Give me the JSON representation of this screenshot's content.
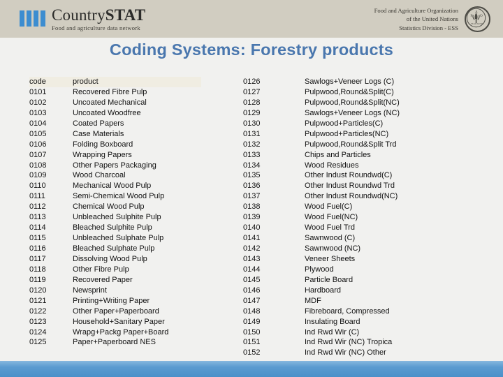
{
  "banner": {
    "brand_name_part1": "Country",
    "brand_name_part2": "STAT",
    "brand_tagline": "Food and agriculture data network",
    "fao_line1": "Food and Agriculture Organization",
    "fao_line2": "of the United Nations",
    "fao_line3": "Statistics Division - ESS",
    "fao_emblem_letters": "FAO",
    "fao_emblem_motto": "FIAT PANIS",
    "brand_bar_color": "#3d8dd0",
    "banner_color": "#d1cdc1"
  },
  "title": "Coding Systems: Forestry products",
  "table": {
    "headers": {
      "code": "code",
      "product": "product"
    },
    "left_rows": [
      {
        "code": "0101",
        "product": "Recovered Fibre Pulp"
      },
      {
        "code": "0102",
        "product": "Uncoated Mechanical"
      },
      {
        "code": "0103",
        "product": "Uncoated Woodfree"
      },
      {
        "code": "0104",
        "product": "Coated Papers"
      },
      {
        "code": "0105",
        "product": "Case Materials"
      },
      {
        "code": "0106",
        "product": "Folding Boxboard"
      },
      {
        "code": "0107",
        "product": "Wrapping Papers"
      },
      {
        "code": "0108",
        "product": "Other Papers Packaging"
      },
      {
        "code": "0109",
        "product": "Wood Charcoal"
      },
      {
        "code": "0110",
        "product": "Mechanical Wood Pulp"
      },
      {
        "code": "0111",
        "product": "Semi-Chemical Wood Pulp"
      },
      {
        "code": "0112",
        "product": "Chemical Wood Pulp"
      },
      {
        "code": "0113",
        "product": "Unbleached Sulphite Pulp"
      },
      {
        "code": "0114",
        "product": "Bleached Sulphite Pulp"
      },
      {
        "code": "0115",
        "product": "Unbleached Sulphate Pulp"
      },
      {
        "code": "0116",
        "product": "Bleached Sulphate Pulp"
      },
      {
        "code": "0117",
        "product": "Dissolving Wood Pulp"
      },
      {
        "code": "0118",
        "product": "Other Fibre Pulp"
      },
      {
        "code": "0119",
        "product": "Recovered Paper"
      },
      {
        "code": "0120",
        "product": "Newsprint"
      },
      {
        "code": "0121",
        "product": "Printing+Writing Paper"
      },
      {
        "code": "0122",
        "product": "Other Paper+Paperboard"
      },
      {
        "code": "0123",
        "product": "Household+Sanitary Paper"
      },
      {
        "code": "0124",
        "product": "Wrapg+Packg Paper+Board"
      },
      {
        "code": "0125",
        "product": "Paper+Paperboard NES"
      }
    ],
    "right_rows": [
      {
        "code": "0126",
        "product": "Sawlogs+Veneer Logs (C)"
      },
      {
        "code": "0127",
        "product": "Pulpwood,Round&Split(C)"
      },
      {
        "code": "0128",
        "product": "Pulpwood,Round&Split(NC)"
      },
      {
        "code": "0129",
        "product": "Sawlogs+Veneer Logs (NC)"
      },
      {
        "code": "0130",
        "product": "Pulpwood+Particles(C)"
      },
      {
        "code": "0131",
        "product": "Pulpwood+Particles(NC)"
      },
      {
        "code": "0132",
        "product": "Pulpwood,Round&Split Trd"
      },
      {
        "code": "0133",
        "product": "Chips and Particles"
      },
      {
        "code": "0134",
        "product": "Wood Residues"
      },
      {
        "code": "0135",
        "product": "Other Indust Roundwd(C)"
      },
      {
        "code": "0136",
        "product": "Other Indust Roundwd Trd"
      },
      {
        "code": "0137",
        "product": "Other Indust Roundwd(NC)"
      },
      {
        "code": "0138",
        "product": "Wood Fuel(C)"
      },
      {
        "code": "0139",
        "product": "Wood Fuel(NC)"
      },
      {
        "code": "0140",
        "product": "Wood Fuel Trd"
      },
      {
        "code": "0141",
        "product": "Sawnwood (C)"
      },
      {
        "code": "0142",
        "product": "Sawnwood (NC)"
      },
      {
        "code": "0143",
        "product": "Veneer Sheets"
      },
      {
        "code": "0144",
        "product": "Plywood"
      },
      {
        "code": "0145",
        "product": "Particle Board"
      },
      {
        "code": "0146",
        "product": "Hardboard"
      },
      {
        "code": "0147",
        "product": "MDF"
      },
      {
        "code": "0148",
        "product": "Fibreboard, Compressed"
      },
      {
        "code": "0149",
        "product": "Insulating Board"
      },
      {
        "code": "0150",
        "product": "Ind Rwd Wir (C)"
      },
      {
        "code": "0151",
        "product": "Ind Rwd Wir (NC) Tropica"
      },
      {
        "code": "0152",
        "product": "Ind Rwd Wir (NC) Other"
      }
    ]
  },
  "footer": {
    "bar_color": "#4b90c9"
  }
}
